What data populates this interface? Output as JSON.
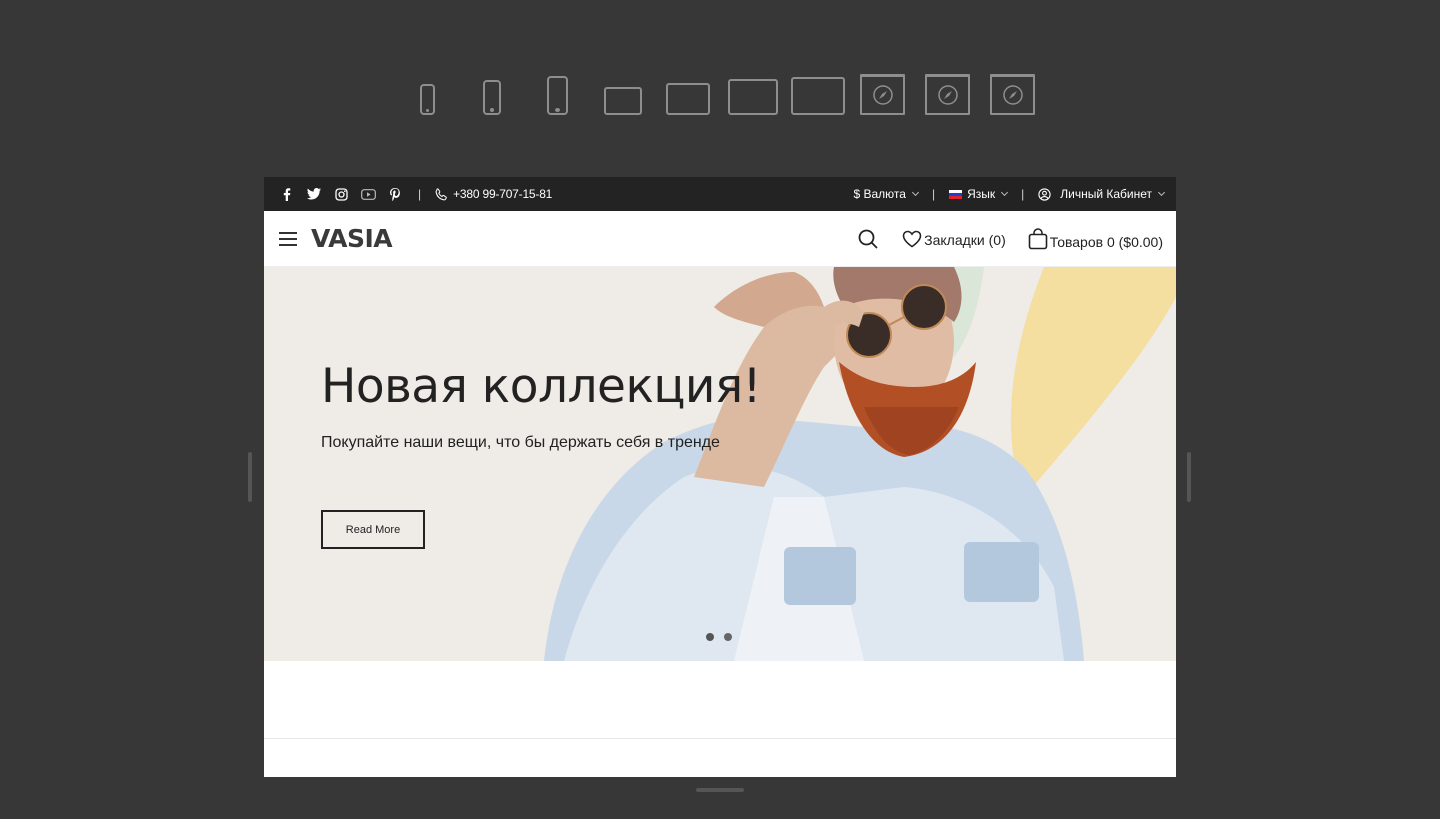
{
  "devices": [
    {
      "name": "phone-small"
    },
    {
      "name": "phone-medium"
    },
    {
      "name": "phone-large"
    },
    {
      "name": "tablet-small"
    },
    {
      "name": "tablet-medium"
    },
    {
      "name": "tablet-large"
    },
    {
      "name": "tablet-xlarge"
    },
    {
      "name": "browser-small"
    },
    {
      "name": "browser-medium"
    },
    {
      "name": "browser-large"
    }
  ],
  "topbar": {
    "social": [
      "facebook-icon",
      "twitter-icon",
      "instagram-icon",
      "youtube-icon",
      "pinterest-icon"
    ],
    "phone": "+380 99-707-15-81",
    "currency": "$ Валюта",
    "language": "Язык",
    "account": "Личный Кабинет"
  },
  "header": {
    "logo": "VASIA",
    "wishlist": "Закладки (0)",
    "cart": "Товаров 0 ($0.00)"
  },
  "hero": {
    "title": "Новая коллекция!",
    "subtitle": "Покупайте наши вещи, что бы держать себя в тренде",
    "button": "Read More",
    "slides": 2,
    "active_slide": 1
  },
  "colors": {
    "page_bg": "#373737",
    "topbar_bg": "#232323",
    "hero_bg": "#efebe6",
    "accent_yellow": "#f4dfa0"
  }
}
